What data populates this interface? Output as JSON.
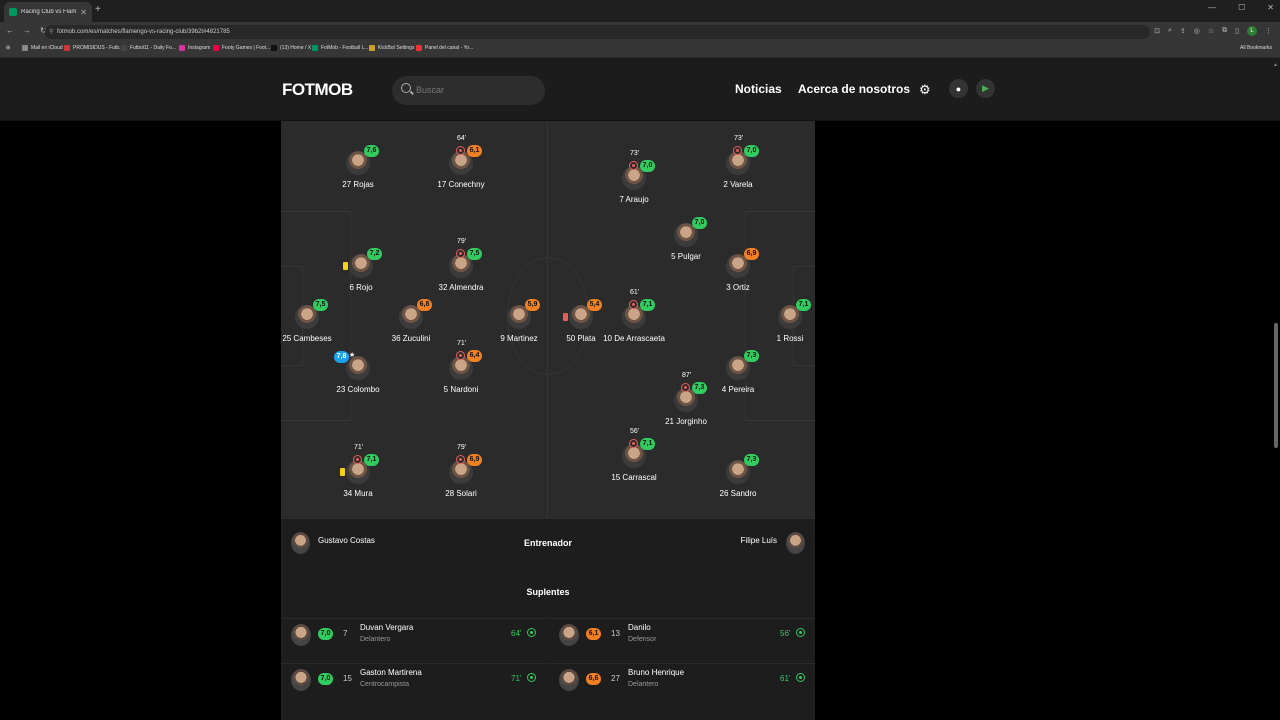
{
  "browser": {
    "tab_title": "Racing Club vs Flamengo - resul",
    "url": "fotmob.com/es/matches/flamengo-vs-racing-club/39b2t#4821785",
    "bookmarks": [
      "Mail en iCloud",
      "PROMISIDUS - Futb...",
      "Futbol11 - Daily Fo...",
      "Instagram",
      "Footy Games | Foot...",
      "(13) Home / X",
      "FotMob - Football L...",
      "KickBot Settings",
      "Panel del canal - Yo..."
    ],
    "all_bookmarks": "All Bookmarks"
  },
  "site": {
    "logo": "FOTMOB",
    "search_placeholder": "Buscar",
    "nav_news": "Noticias",
    "nav_about": "Acerca de nosotros"
  },
  "pitch": {
    "racing": [
      {
        "name": "27 Rojas",
        "rating": "7,6",
        "color": "g"
      },
      {
        "name": "17 Conechny",
        "rating": "6,1",
        "color": "o",
        "sub_min": "64'"
      },
      {
        "name": "6 Rojo",
        "rating": "7,2",
        "color": "g",
        "card": "yellow"
      },
      {
        "name": "32 Almendra",
        "rating": "7,5",
        "color": "g",
        "sub_min": "79'"
      },
      {
        "name": "25 Cambeses",
        "rating": "7,5",
        "color": "g"
      },
      {
        "name": "36 Zuculini",
        "rating": "6,8",
        "color": "o"
      },
      {
        "name": "9 Martinez",
        "rating": "5,9",
        "color": "o"
      },
      {
        "name": "23 Colombo",
        "rating": "7,8",
        "color": "b"
      },
      {
        "name": "5 Nardoni",
        "rating": "6,4",
        "color": "o",
        "sub_min": "71'"
      },
      {
        "name": "34 Mura",
        "rating": "7,1",
        "color": "g",
        "sub_min": "71'",
        "card": "yellow"
      },
      {
        "name": "28 Solari",
        "rating": "6,9",
        "color": "o",
        "sub_min": "79'"
      }
    ],
    "flamengo": [
      {
        "name": "7 Araujo",
        "rating": "7,0",
        "color": "g",
        "sub_min": "73'"
      },
      {
        "name": "2 Varela",
        "rating": "7,0",
        "color": "g",
        "sub_min": "73'"
      },
      {
        "name": "5 Pulgar",
        "rating": "7,0",
        "color": "g"
      },
      {
        "name": "3 Ortiz",
        "rating": "6,9",
        "color": "o"
      },
      {
        "name": "50 Plata",
        "rating": "5,4",
        "color": "o",
        "card": "red"
      },
      {
        "name": "10 De Arrascaeta",
        "rating": "7,1",
        "color": "g",
        "sub_min": "61'"
      },
      {
        "name": "1 Rossi",
        "rating": "7,1",
        "color": "g"
      },
      {
        "name": "4 Pereira",
        "rating": "7,3",
        "color": "g"
      },
      {
        "name": "21 Jorginho",
        "rating": "7,3",
        "color": "g",
        "sub_min": "87'"
      },
      {
        "name": "15 Carrascal",
        "rating": "7,1",
        "color": "g",
        "sub_min": "56'"
      },
      {
        "name": "26 Sandro",
        "rating": "7,3",
        "color": "g"
      }
    ]
  },
  "coaches": {
    "title": "Entrenador",
    "home": "Gustavo Costas",
    "away": "Filipe Luís"
  },
  "bench": {
    "title": "Suplentes",
    "home": [
      {
        "rating": "7,0",
        "num": "7",
        "name": "Duvan Vergara",
        "pos": "Delantero",
        "min": "64'"
      },
      {
        "rating": "7,0",
        "num": "15",
        "name": "Gaston Martirena",
        "pos": "Centrocampista",
        "min": "71'"
      }
    ],
    "away": [
      {
        "rating": "6,1",
        "num": "13",
        "name": "Danilo",
        "pos": "Defensor",
        "min": "56'"
      },
      {
        "rating": "6,6",
        "num": "27",
        "name": "Bruno Henrique",
        "pos": "Delantero",
        "min": "61'"
      }
    ]
  }
}
